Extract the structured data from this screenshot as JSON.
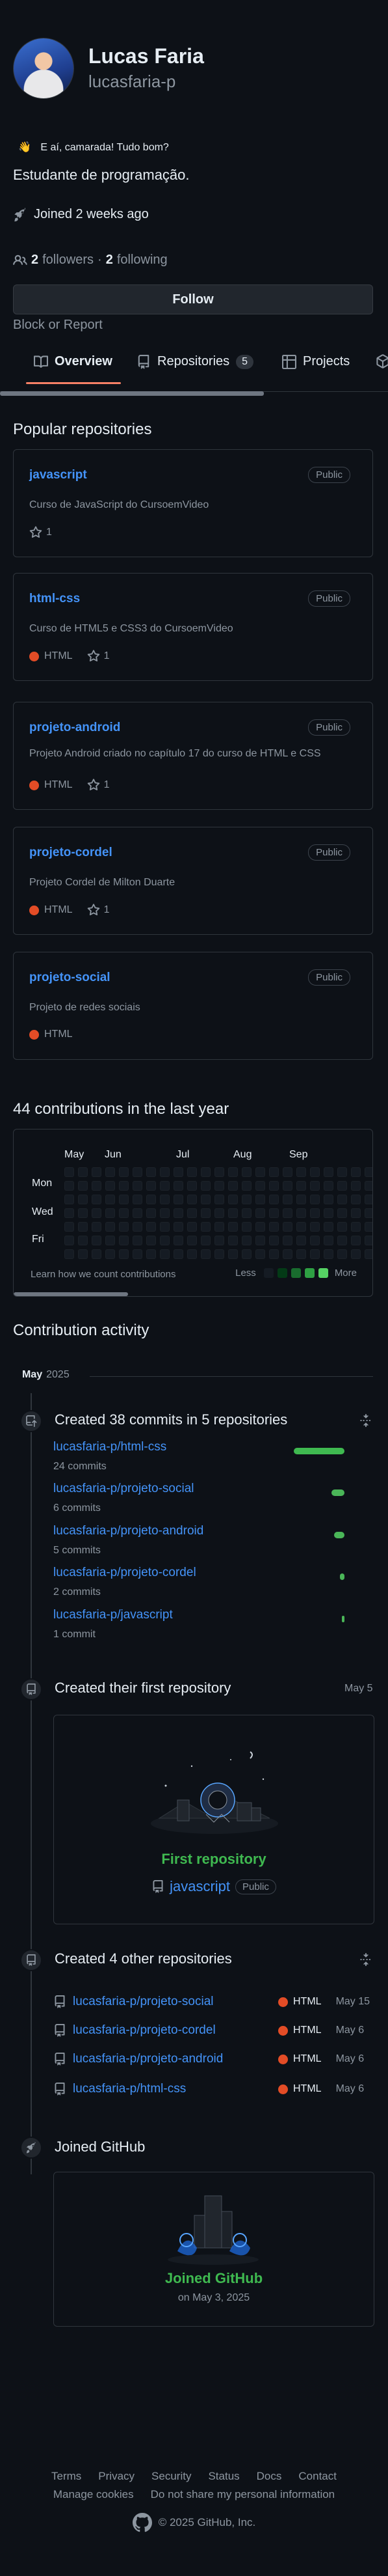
{
  "profile": {
    "full_name": "Lucas Faria",
    "username": "lucasfaria-p",
    "status_emoji": "👋",
    "status_text": "E aí, camarada! Tudo bom?",
    "bio": "Estudante de programação.",
    "joined": "Joined 2 weeks ago",
    "followers_count": "2",
    "followers_label": "followers",
    "separator": "·",
    "following_count": "2",
    "following_label": "following",
    "follow_button": "Follow",
    "block_report": "Block or Report"
  },
  "tabs": [
    {
      "label": "Overview",
      "icon": "book-icon",
      "active": true
    },
    {
      "label": "Repositories",
      "icon": "repo-icon",
      "counter": "5"
    },
    {
      "label": "Projects",
      "icon": "table-icon"
    }
  ],
  "popular": {
    "title": "Popular repositories",
    "repos": [
      {
        "name": "javascript",
        "visibility": "Public",
        "description": "Curso de JavaScript do CursoemVideo",
        "language": "",
        "stars": "1"
      },
      {
        "name": "html-css",
        "visibility": "Public",
        "description": "Curso de HTML5 e CSS3 do CursoemVideo",
        "language": "HTML",
        "stars": "1"
      },
      {
        "name": "projeto-android",
        "visibility": "Public",
        "description": "Projeto Android criado no capítulo 17 do curso de HTML e CSS",
        "language": "HTML",
        "stars": "1"
      },
      {
        "name": "projeto-cordel",
        "visibility": "Public",
        "description": "Projeto Cordel de Milton Duarte",
        "language": "HTML",
        "stars": "1"
      },
      {
        "name": "projeto-social",
        "visibility": "Public",
        "description": "Projeto de redes sociais",
        "language": "HTML",
        "stars": ""
      }
    ]
  },
  "contributions": {
    "title": "44 contributions in the last year",
    "months": [
      "May",
      "Jun",
      "Jul",
      "Aug",
      "Sep"
    ],
    "days": [
      "Mon",
      "Wed",
      "Fri"
    ],
    "learn_link": "Learn how we count contributions",
    "legend_less": "Less",
    "legend_more": "More",
    "legend_colors": [
      "#151b23",
      "#033a16",
      "#196c2e",
      "#2ea043",
      "#56d364"
    ]
  },
  "activity": {
    "title": "Contribution activity",
    "month": "May",
    "year": "2025",
    "commits": {
      "title": "Created 38 commits in 5 repositories",
      "items": [
        {
          "repo": "lucasfaria-p/html-css",
          "count": "24 commits",
          "value": 24
        },
        {
          "repo": "lucasfaria-p/projeto-social",
          "count": "6 commits",
          "value": 6
        },
        {
          "repo": "lucasfaria-p/projeto-android",
          "count": "5 commits",
          "value": 5
        },
        {
          "repo": "lucasfaria-p/projeto-cordel",
          "count": "2 commits",
          "value": 2
        },
        {
          "repo": "lucasfaria-p/javascript",
          "count": "1 commit",
          "value": 1
        }
      ]
    },
    "first_repo": {
      "title": "Created their first repository",
      "date": "May 5",
      "card_title": "First repository",
      "repo": "javascript",
      "visibility": "Public"
    },
    "other_repos": {
      "title": "Created 4 other repositories",
      "items": [
        {
          "repo": "lucasfaria-p/projeto-social",
          "language": "HTML",
          "date": "May 15"
        },
        {
          "repo": "lucasfaria-p/projeto-cordel",
          "language": "HTML",
          "date": "May 6"
        },
        {
          "repo": "lucasfaria-p/projeto-android",
          "language": "HTML",
          "date": "May 6"
        },
        {
          "repo": "lucasfaria-p/html-css",
          "language": "HTML",
          "date": "May 6"
        }
      ]
    },
    "joined": {
      "title": "Joined GitHub",
      "card_title": "Joined GitHub",
      "date": "on May 3, 2025"
    }
  },
  "footer": {
    "row1": [
      "Terms",
      "Privacy",
      "Security",
      "Status",
      "Docs",
      "Contact"
    ],
    "row2": [
      "Manage cookies",
      "Do not share my personal information"
    ],
    "copyright": "© 2025 GitHub, Inc."
  },
  "colors": {
    "background": "#0d1117",
    "link": "#4493f8",
    "html_language": "#e34c26",
    "success": "#3fb950",
    "tab_accent": "#f78166"
  }
}
